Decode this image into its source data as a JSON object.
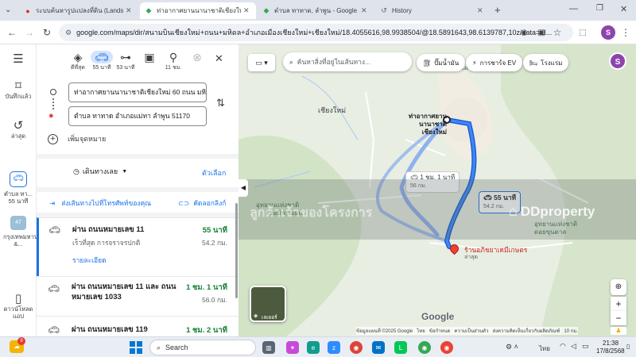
{
  "tabs": [
    {
      "title": "ระบบค้นหารูปแปลงที่ดิน (LandsMap)",
      "active": false
    },
    {
      "title": "ท่าอากาศยานนานาชาติเชียงใหม่ ถึง",
      "active": true
    },
    {
      "title": "ตำบล ทาทาด, ลำพูน - Google Ma",
      "active": false
    },
    {
      "title": "History",
      "active": false
    }
  ],
  "toolbar": {
    "url": "google.com/maps/dir/สนามบินเชียงใหม่+ถนน+มหิดล+อำเภอเมืองเชียงใหม่+เชียงใหม่/18.4055616,98.9938504/@18.5891643,98.6139787,10z/data=!3...",
    "profile_letter": "S"
  },
  "leftnav": {
    "saved": "บันทึกแล้ว",
    "recent": "ล่าสุด",
    "recent_place_1": "ตำบล ทา... 55 นาที",
    "recent_place_2": "กรุงเทพมหานคร &...",
    "recent_place_2_badge": "47",
    "download": "ดาวน์โหลดแอป"
  },
  "modes": [
    {
      "label": "ดีที่สุด",
      "icon": "best-route-icon"
    },
    {
      "label": "55 นาที",
      "icon": "car-icon"
    },
    {
      "label": "53 นาที",
      "icon": "motorcycle-icon"
    },
    {
      "label": "",
      "icon": "transit-icon"
    },
    {
      "label": "11 ชม.",
      "icon": "walk-icon"
    },
    {
      "label": "",
      "icon": "bicycle-icon"
    }
  ],
  "directions": {
    "origin": "ท่าอากาศยานนานาชาติเชียงใหม่ 60 ถนน มหิ",
    "destination": "ตำบล ทาทาด อำเภอแม่ทา ลำพูน 51170",
    "add_stop": "เพิ่มจุดหมาย",
    "depart": "เดินทางเลย",
    "options": "ตัวเลือก",
    "send_phone": "ส่งเส้นทางไปที่โทรศัพท์ของคุณ",
    "copy_link": "คัดลอกลิงก์"
  },
  "routes": [
    {
      "title": "ผ่าน ถนนหมายเลข 11",
      "time": "55 นาที",
      "distance": "54.2 กม.",
      "sub": "เร็วที่สุด การจราจรปกติ",
      "details": "รายละเอียด"
    },
    {
      "title": "ผ่าน ถนนหมายเลข 11 และ ถนนหมายเลข 1033",
      "time": "1 ชม. 1 นาที",
      "distance": "56.0 กม."
    },
    {
      "title": "ผ่าน ถนนหมายเลข 119",
      "time": "1 ชม. 2 นาที",
      "distance": ""
    }
  ],
  "map": {
    "search_placeholder": "ค้นหาสิ่งที่อยู่ในเส้นทาง...",
    "chip_gas": "ปั๊มน้ำมัน",
    "chip_ev": "การชาร์จ EV",
    "chip_hotel": "โรงแรม",
    "label_cm": "เชียงใหม่",
    "label_airport": "ท่าอากาศยานนานาชาติเชียงใหม่",
    "label_dest": "ร้านอภิชยาเคมีเกษตร",
    "label_dest_sub": "ล่าสุด",
    "label_top": "เมืองเชียง",
    "label_right_1": "อุทยานแห่งชาติ",
    "label_right_2": "ดอยขุนตาล",
    "label_left": "อุทยานแห่งชาติ",
    "label_left2": "ดอยอินทนนท์",
    "route_main_time": "55 นาที",
    "route_main_dist": "54.2 กม.",
    "route_alt_time": "1 ชม. 1 นาที",
    "route_alt_dist": "56 กม.",
    "layers": "เลเยอร์",
    "google": "Google",
    "footer": "ข้อมูลแผนที่ ©2025 Google   ไทย   ข้อกำหนด   ความเป็นส่วนตัว   ส่งความคิดเห็นเกี่ยวกับผลิตภัณฑ์   10 กม.",
    "watermark": "DDproperty",
    "banner_text": "ลูกค้าเจ้าของโครงการ"
  },
  "taskbar": {
    "search": "Search",
    "lang": "ไทย",
    "time": "21:38",
    "date": "17/8/2568",
    "weather_badge": "9"
  },
  "colors": {
    "route_main": "#1a73e8",
    "route_alt": "#8fb1f0",
    "dest_pin": "#ea4335",
    "green_time": "#188038"
  }
}
